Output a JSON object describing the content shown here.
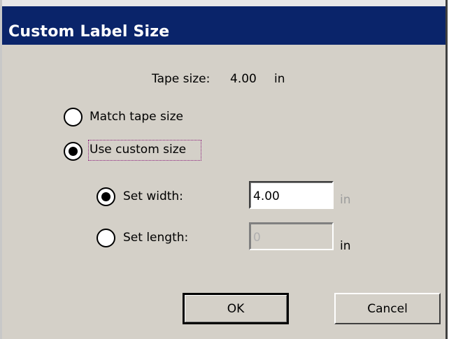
{
  "window": {
    "title": "Custom Label Size"
  },
  "tape": {
    "label": "Tape size:",
    "value": "4.00",
    "unit": "in"
  },
  "options": {
    "match_tape": {
      "label": "Match tape size",
      "selected": false
    },
    "use_custom": {
      "label": "Use custom size",
      "selected": true
    }
  },
  "custom": {
    "width": {
      "label": "Set width:",
      "value": "4.00",
      "unit": "in",
      "selected": true,
      "enabled": true
    },
    "length": {
      "label": "Set length:",
      "value": "0",
      "unit": "in",
      "selected": false,
      "enabled": false
    }
  },
  "buttons": {
    "ok": "OK",
    "cancel": "Cancel"
  }
}
